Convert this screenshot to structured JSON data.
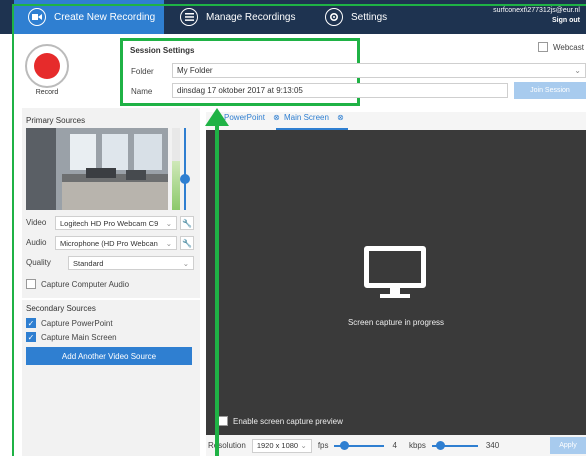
{
  "tabs": {
    "create": "Create New Recording",
    "manage": "Manage Recordings",
    "settings": "Settings"
  },
  "user": {
    "email": "surfconext\\277312js@eur.nl",
    "signout": "Sign out"
  },
  "record": {
    "label": "Record"
  },
  "session": {
    "title": "Session Settings",
    "folder_label": "Folder",
    "folder_value": "My Folder",
    "name_label": "Name",
    "name_value": "dinsdag 17 oktober 2017 at 9:13:05",
    "join_label": "Join Session",
    "webcast_label": "Webcast"
  },
  "primary": {
    "title": "Primary Sources",
    "video_label": "Video",
    "video_value": "Logitech HD Pro Webcam C9",
    "audio_label": "Audio",
    "audio_value": "Microphone (HD Pro Webcan",
    "quality_label": "Quality",
    "quality_value": "Standard",
    "capture_audio_label": "Capture Computer Audio"
  },
  "secondary": {
    "title": "Secondary Sources",
    "powerpoint_label": "Capture PowerPoint",
    "mainscreen_label": "Capture Main Screen",
    "add_button": "Add Another Video Source"
  },
  "preview": {
    "tab_powerpoint": "PowerPoint",
    "tab_mainscreen": "Main Screen",
    "status": "Screen capture in progress",
    "enable_preview": "Enable screen capture preview"
  },
  "bottombar": {
    "resolution_label": "Resolution",
    "resolution_value": "1920 x 1080",
    "fps_label": "fps",
    "fps_value": "4",
    "kbps_label": "kbps",
    "kbps_value": "340",
    "apply_label": "Apply"
  },
  "colors": {
    "accent": "#2f7fd1",
    "header": "#1e3350",
    "annotation": "#1fb245",
    "record": "#e62b2b"
  }
}
